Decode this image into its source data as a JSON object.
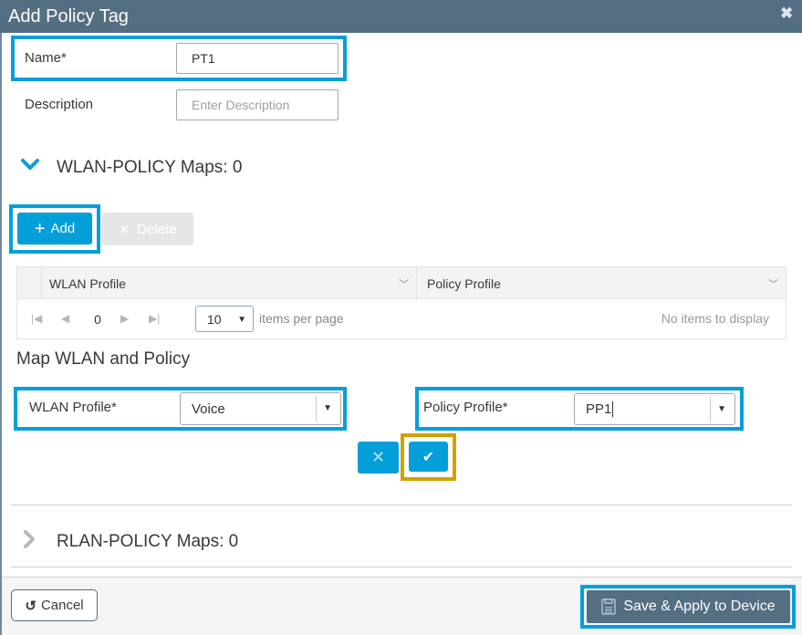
{
  "dialog": {
    "title": "Add Policy Tag",
    "close_icon": "close-icon"
  },
  "form": {
    "name_label": "Name*",
    "name_value": "PT1",
    "description_label": "Description",
    "description_placeholder": "Enter Description"
  },
  "wlan_section": {
    "title": "WLAN-POLICY Maps: 0",
    "expanded": true,
    "add_label": "Add",
    "delete_label": "Delete",
    "grid": {
      "columns": [
        "WLAN Profile",
        "Policy Profile"
      ],
      "rows": [],
      "page": "0",
      "page_size": "10",
      "items_per_page_label": "items per page",
      "empty_text": "No items to display"
    }
  },
  "map_section": {
    "title": "Map WLAN and Policy",
    "wlan_profile_label": "WLAN Profile*",
    "wlan_profile_value": "Voice",
    "policy_profile_label": "Policy Profile*",
    "policy_profile_value": "PP1",
    "cancel_icon": "✕",
    "confirm_icon": "✔"
  },
  "rlan_section": {
    "title": "RLAN-POLICY Maps: 0",
    "expanded": false
  },
  "footer": {
    "cancel_label": "Cancel",
    "save_label": "Save & Apply to Device"
  },
  "colors": {
    "titlebar": "#546e82",
    "primary": "#049fd9",
    "highlight_blue": "#049fd9",
    "highlight_gold": "#d4a000"
  }
}
